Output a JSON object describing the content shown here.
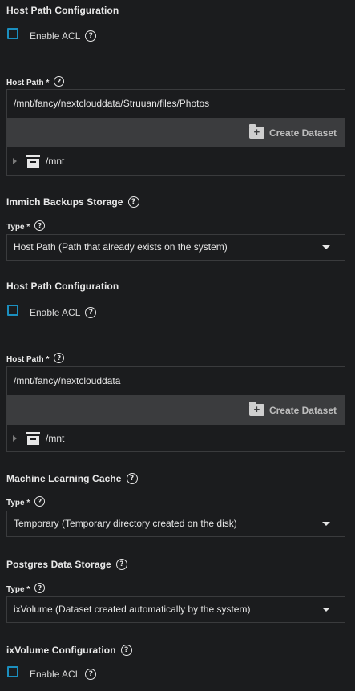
{
  "host_path_config_1": {
    "title": "Host Path Configuration",
    "enable_acl_label": "Enable ACL",
    "host_path_label": "Host Path *",
    "host_path_value": "/mnt/fancy/nextclouddata/Struuan/files/Photos",
    "create_dataset_label": "Create Dataset",
    "tree_root_label": "/mnt"
  },
  "immich_backups": {
    "title": "Immich Backups Storage",
    "type_label": "Type *",
    "type_value": "Host Path (Path that already exists on the system)"
  },
  "host_path_config_2": {
    "title": "Host Path Configuration",
    "enable_acl_label": "Enable ACL",
    "host_path_label": "Host Path *",
    "host_path_value": "/mnt/fancy/nextclouddata",
    "create_dataset_label": "Create Dataset",
    "tree_root_label": "/mnt"
  },
  "ml_cache": {
    "title": "Machine Learning Cache",
    "type_label": "Type *",
    "type_value": "Temporary (Temporary directory created on the disk)"
  },
  "postgres": {
    "title": "Postgres Data Storage",
    "type_label": "Type *",
    "type_value": "ixVolume (Dataset created automatically by the system)"
  },
  "ixvolume_config": {
    "title": "ixVolume Configuration",
    "enable_acl_label": "Enable ACL"
  },
  "colors": {
    "background": "#1b1c1e",
    "checkbox_border": "#1b8fbf",
    "create_bar": "#3b3c3e"
  }
}
